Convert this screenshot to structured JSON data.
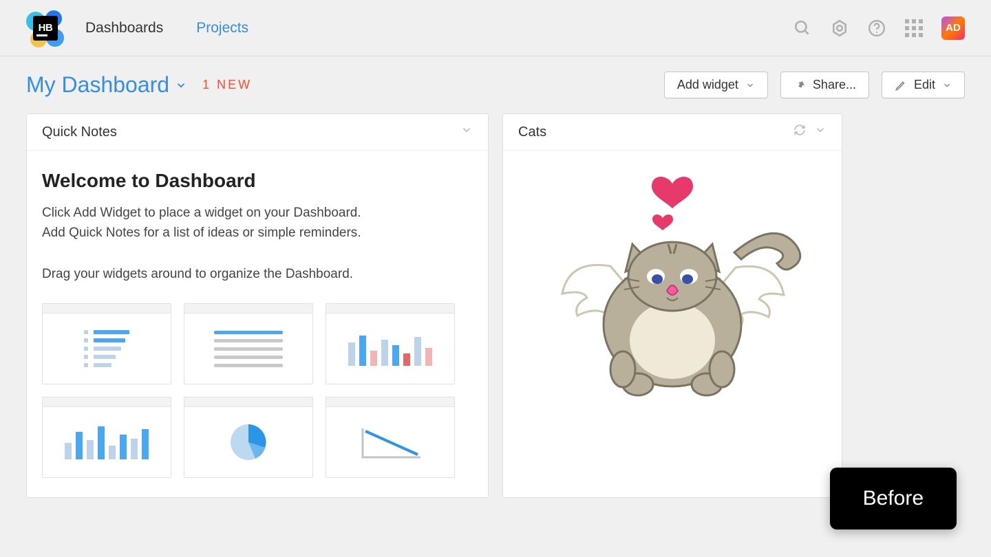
{
  "nav": {
    "dashboards": "Dashboards",
    "projects": "Projects"
  },
  "avatar_initials": "AD",
  "dashboard": {
    "title": "My Dashboard",
    "new_badge": "1 NEW"
  },
  "buttons": {
    "add_widget": "Add widget",
    "share": "Share...",
    "edit": "Edit"
  },
  "widgets": {
    "quick_notes": {
      "title": "Quick Notes",
      "heading": "Welcome to Dashboard",
      "line1": "Click Add Widget to place a widget on your Dashboard.",
      "line2": "Add Quick Notes for a list of ideas or simple reminders.",
      "line3": "Drag your widgets around to organize the Dashboard."
    },
    "cats": {
      "title": "Cats"
    }
  },
  "overlay_badge": "Before"
}
